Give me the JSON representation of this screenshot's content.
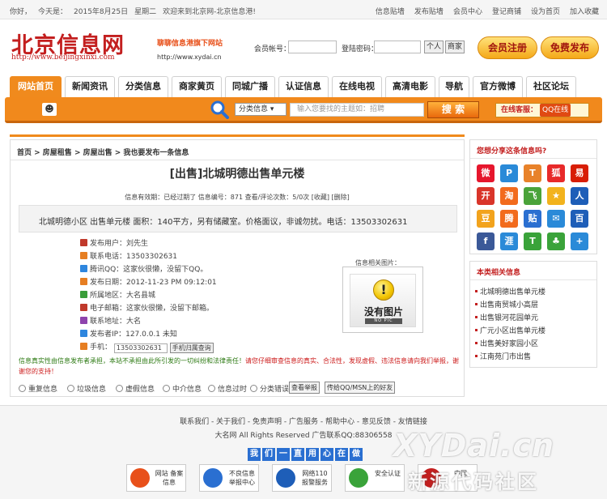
{
  "topbar": {
    "greeting": "你好，",
    "date_prefix": "今天是：",
    "date": "2015年8月25日",
    "weekday": "星期二",
    "welcome": "欢迎来到北京网-北京信息港!",
    "links": [
      "信息贴墙",
      "发布贴墙",
      "会员中心",
      "登记商铺",
      "设为首页",
      "加入收藏"
    ]
  },
  "header": {
    "logo": "北京信息网",
    "logo_url": "http://www.beijingxinxi.com",
    "slogan": "聊聊信息港旗下网站",
    "slogan_url": "http://www.xydai.cn",
    "account_label": "会员帐号：",
    "password_label": "登陆密码：",
    "personal_btn": "个人",
    "merchant_btn": "商家",
    "register_btn": "会员注册",
    "publish_btn": "免费发布"
  },
  "nav": {
    "tabs": [
      "网站首页",
      "新闻资讯",
      "分类信息",
      "商家黄页",
      "同城广播",
      "认证信息",
      "在线电视",
      "高清电影",
      "导航",
      "官方微博",
      "社区论坛"
    ]
  },
  "search": {
    "category": "分类信息",
    "placeholder": "输入您要找的主题如：招聘",
    "button": "搜 索",
    "service_label": "在线客服：",
    "qq_label": "QQ在线"
  },
  "main": {
    "breadcrumb": "首页 > 房屋租售 > 房屋出售 > 我也要发布一条信息",
    "title": "[出售]北城明德出售单元楼",
    "meta": "信息有效期：已经过期了 信息编号：871 查看/评论次数：5/0次 [收藏] [删除]",
    "description": "北城明德小区 出售单元楼 面积：140平方，另有储藏室。价格面议，非诚勿扰。电话：13503302631",
    "info_rows": [
      {
        "label": "发布用户：",
        "value": "刘先生",
        "color": "#c0392b"
      },
      {
        "label": "联系电话：",
        "value": "13503302631",
        "color": "#e67e22"
      },
      {
        "label": "腾讯QQ：",
        "value": "这家伙很懒，没留下QQ。",
        "color": "#2e86de"
      },
      {
        "label": "发布日期：",
        "value": "2012-11-23 PM 09:12:01",
        "color": "#e67e22"
      },
      {
        "label": "所属地区：",
        "value": "大名县城",
        "color": "#3a9d3a"
      },
      {
        "label": "电子邮箱：",
        "value": "这家伙很懒，没留下邮箱。",
        "color": "#c0392b"
      },
      {
        "label": "联系地址：",
        "value": "大名",
        "color": "#8e44ad"
      },
      {
        "label": "发布者IP：",
        "value": "127.0.0.1 未知",
        "color": "#2e86de"
      }
    ],
    "phone_label": "手机：",
    "phone_value": "13503302631",
    "phone_btn": "手机归属查询",
    "image_label": "信息相关图片：",
    "no_image": "没有图片",
    "no_image_sub": "NO PIC",
    "disclaimer_green": "信息真实性由信息发布者承担，本站不承担由此所引发的一切纠纷和法律责任！",
    "disclaimer_red": "请您仔细审查信息的真实、合法性，发现虚假、违法信息请向我们举报，谢谢您的支持！",
    "report_options": [
      "重复信息",
      "垃圾信息",
      "虚假信息",
      "中介信息",
      "信息过时",
      "分类错误"
    ],
    "report_btn": "查看举报",
    "msn_btn": "传给QQ/MSN上的好友"
  },
  "sidebar": {
    "share_title": "您想分享这条信息吗?",
    "share_icons": [
      {
        "name": "sina-weibo-icon",
        "glyph": "微",
        "color": "#e6162d"
      },
      {
        "name": "renren-icon",
        "glyph": "P",
        "color": "#2a8ad8"
      },
      {
        "name": "tianya-icon",
        "glyph": "T",
        "color": "#e8822a"
      },
      {
        "name": "sohu-icon",
        "glyph": "狐",
        "color": "#e82a2a"
      },
      {
        "name": "netease-icon",
        "glyph": "易",
        "color": "#d81e06"
      },
      {
        "name": "kaixin-icon",
        "glyph": "开",
        "color": "#d9352a"
      },
      {
        "name": "taobao-icon",
        "glyph": "淘",
        "color": "#f26b1d"
      },
      {
        "name": "feixin-icon",
        "glyph": "飞",
        "color": "#4aa33a"
      },
      {
        "name": "qq-zone-icon",
        "glyph": "★",
        "color": "#f2b31d"
      },
      {
        "name": "renren-people-icon",
        "glyph": "人",
        "color": "#1e5eb8"
      },
      {
        "name": "douban-icon",
        "glyph": "豆",
        "color": "#f2a31d"
      },
      {
        "name": "qq-weibo-icon",
        "glyph": "腾",
        "color": "#f26b1d"
      },
      {
        "name": "baidu-tieba-icon",
        "glyph": "贴",
        "color": "#2a6fd1"
      },
      {
        "name": "email-icon",
        "glyph": "✉",
        "color": "#2a8ad8"
      },
      {
        "name": "baidu-icon",
        "glyph": "百",
        "color": "#1e5eb8"
      },
      {
        "name": "facebook-icon",
        "glyph": "f",
        "color": "#3b5998"
      },
      {
        "name": "pengyou-icon",
        "glyph": "涯",
        "color": "#2a8ad8"
      },
      {
        "name": "t-icon",
        "glyph": "T",
        "color": "#3aa33a"
      },
      {
        "name": "clover-icon",
        "glyph": "♣",
        "color": "#3aa33a"
      },
      {
        "name": "more-share-icon",
        "glyph": "+",
        "color": "#2a8ad8"
      }
    ],
    "related_title": "本类相关信息",
    "related": [
      "北城明德出售单元楼",
      "出售南贸城小高层",
      "出售银河花园单元",
      "广元小区出售单元楼",
      "出售美好家园小区",
      "江南苑门市出售"
    ]
  },
  "footer": {
    "links": "联系我们 - 关于我们 - 免责声明 - 广告服务 - 帮助中心 - 意见反馈 - 友情链接",
    "copyright": "大名网 All Rights Reserved 广告联系QQ:88306558",
    "banner": [
      "我",
      "们",
      "一",
      "直",
      "用",
      "心",
      "在",
      "做"
    ],
    "badges": [
      {
        "text": "网站 备案信息",
        "color": "#e8501a"
      },
      {
        "text": "不良信息 举报中心",
        "color": "#2a6fd1"
      },
      {
        "text": "网络110 报警服务",
        "color": "#1e5eb8"
      },
      {
        "text": "安全认证",
        "color": "#3aa33a"
      },
      {
        "text": "中国",
        "color": "#c31f1f"
      }
    ],
    "watermark": "XYDai.cn",
    "watermark_sub": "新源代码社区"
  }
}
